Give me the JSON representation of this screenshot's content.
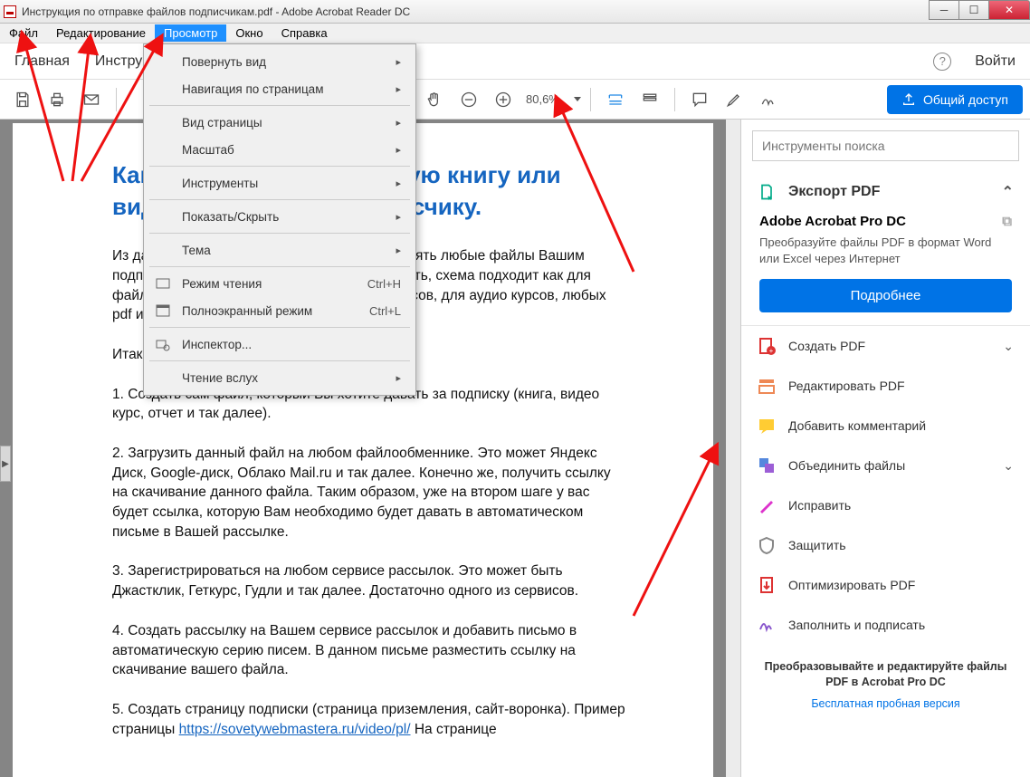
{
  "window": {
    "title": "Инструкция по отправке файлов подписчикам.pdf - Adobe Acrobat Reader DC"
  },
  "menubar": {
    "file": "Файл",
    "edit": "Редактирование",
    "view": "Просмотр",
    "window": "Окно",
    "help": "Справка"
  },
  "tabs": {
    "home": "Главная",
    "tools": "Инструменты",
    "signin": "Войти"
  },
  "toolbar": {
    "zoom": "80,6%",
    "share": "Общий доступ"
  },
  "dropdown": {
    "rotate": "Повернуть вид",
    "nav": "Навигация по страницам",
    "pageview": "Вид страницы",
    "zoom": "Масштаб",
    "tools": "Инструменты",
    "showhide": "Показать/Скрыть",
    "theme": "Тема",
    "readmode": "Режим чтения",
    "readmode_sc": "Ctrl+H",
    "fullscreen": "Полноэкранный режим",
    "fullscreen_sc": "Ctrl+L",
    "inspector": "Инспектор...",
    "readaloud": "Чтение вслух"
  },
  "doc": {
    "h1": "Как отправить электронную книгу или видео курс своему подписчику.",
    "p1": "Из данной инструкции Вы узнаете как отправлять любые файлы Вашим подписчикам в автоматическом режиме. То есть, схема подходит как для файлов, для электронных книг, для видео курсов, для аудио курсов, любых pdf и так далее.",
    "p2": "Итак, давайте все разберем по шагам:",
    "p3": "1. Создать сам файл, который Вы хотите давать за подписку (книга, видео курс, отчет и так далее).",
    "p4": "2. Загрузить данный файл на любом файлообменнике. Это может Яндекс Диск, Google-диск, Облако Mail.ru и так далее. Конечно же, получить ссылку на скачивание данного файла. Таким образом, уже на втором шаге у вас будет ссылка, которую Вам необходимо будет давать в автоматическом письме в Вашей рассылке.",
    "p5": "3. Зарегистрироваться на любом сервисе рассылок. Это может быть Джастклик, Геткурс, Гудли и так далее. Достаточно одного из сервисов.",
    "p6": "4. Создать рассылку на Вашем сервисе рассылок и добавить письмо в автоматическую серию писем. В данном письме разместить ссылку на скачивание вашего файла.",
    "p7a": "5. Создать страницу подписки (страница приземления, сайт-воронка). Пример страницы ",
    "p7link": "https://sovetywebmastera.ru/video/pl/",
    "p7b": " На странице"
  },
  "side": {
    "search_ph": "Инструменты поиска",
    "export": "Экспорт PDF",
    "pro_title": "Adobe Acrobat Pro DC",
    "pro_desc": "Преобразуйте файлы PDF в формат Word или Excel через Интернет",
    "more": "Подробнее",
    "create": "Создать PDF",
    "editpdf": "Редактировать PDF",
    "comment": "Добавить комментарий",
    "combine": "Объединить файлы",
    "fix": "Исправить",
    "protect": "Защитить",
    "optimize": "Оптимизировать PDF",
    "fillsign": "Заполнить и подписать",
    "footer1": "Преобразовывайте и редактируйте файлы PDF в Acrobat Pro DC",
    "footer2": "Бесплатная пробная версия"
  }
}
